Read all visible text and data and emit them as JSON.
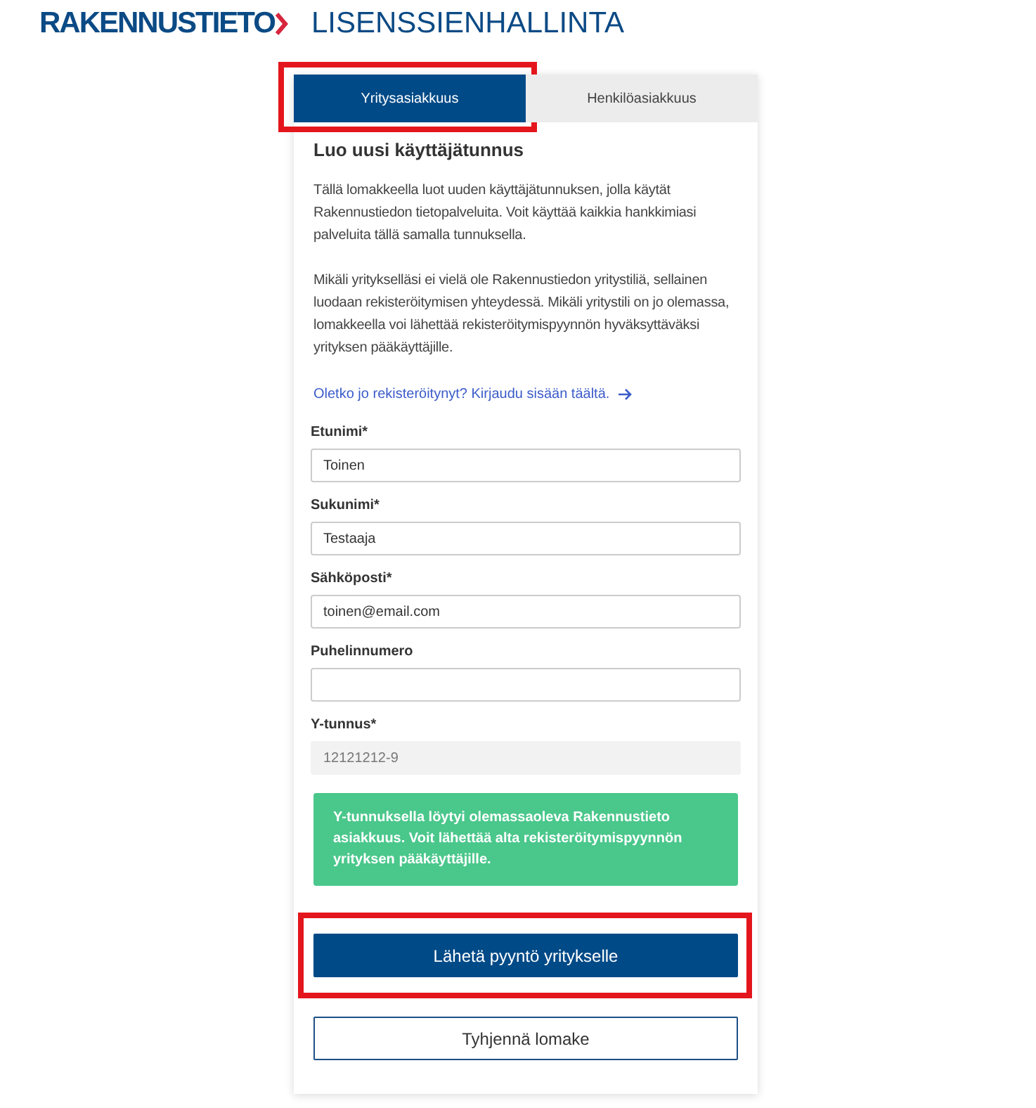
{
  "header": {
    "brand": "RAKENNUSTIETO",
    "title": "LISENSSIENHALLINTA"
  },
  "tabs": [
    {
      "label": "Yritysasiakkuus",
      "selected": true,
      "highlighted": true
    },
    {
      "label": "Henkilöasiakkuus",
      "selected": false,
      "highlighted": false
    }
  ],
  "form": {
    "heading": "Luo uusi käyttäjätunnus",
    "paragraphs": [
      "Tällä lomakkeella luot uuden käyttäjätunnuksen, jolla käytät Rakennustiedon tietopalveluita. Voit käyttää kaikkia hankkimiasi palveluita tällä samalla tunnuksella.",
      "Mikäli yritykselläsi ei vielä ole Rakennustiedon yritystiliä, sellainen luodaan rekisteröitymisen yhteydessä. Mikäli yritystili on jo olemassa, lomakkeella voi lähettää rekisteröitymispyynnön hyväksyttäväksi yrityksen pääkäyttäjille."
    ],
    "login_link": "Oletko jo rekisteröitynyt? Kirjaudu sisään täältä.",
    "fields": [
      {
        "label": "Etunimi*",
        "value": "Toinen",
        "disabled": false
      },
      {
        "label": "Sukunimi*",
        "value": "Testaaja",
        "disabled": false
      },
      {
        "label": "Sähköposti*",
        "value": "toinen@email.com",
        "disabled": false
      },
      {
        "label": "Puhelinnumero",
        "disabled": false
      },
      {
        "label": "Y-tunnus*",
        "value": "12121212-9",
        "disabled": true
      }
    ],
    "notice": "Y-tunnuksella löytyi olemassaoleva Rakennustieto asiakkuus. Voit lähettää alta rekisteröitymispyynnön yrityksen pääkäyttäjille.",
    "buttons": [
      {
        "label": "Lähetä pyyntö yritykselle",
        "kind": "primary",
        "highlighted": true
      },
      {
        "label": "Tyhjennä lomake",
        "kind": "secondary",
        "highlighted": false
      }
    ]
  }
}
